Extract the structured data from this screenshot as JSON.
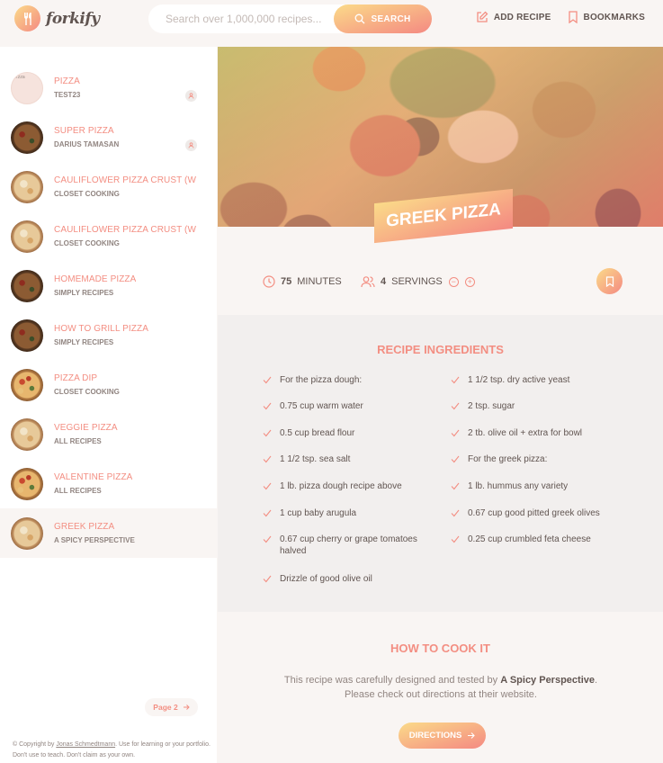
{
  "header": {
    "logo_text": "forkify",
    "search_placeholder": "Search over 1,000,000 recipes...",
    "search_label": "SEARCH",
    "nav": {
      "add_recipe": "ADD RECIPE",
      "bookmarks": "BOOKMARKS"
    }
  },
  "results": [
    {
      "title": "PIZZA",
      "publisher": "TEST23",
      "user": true,
      "thumb_alt": "pizza"
    },
    {
      "title": "SUPER PIZZA",
      "publisher": "DARIUS TAMASAN",
      "user": true
    },
    {
      "title": "CAULIFLOWER PIZZA CRUST (WIT...",
      "publisher": "CLOSET COOKING"
    },
    {
      "title": "CAULIFLOWER PIZZA CRUST (WIT...",
      "publisher": "CLOSET COOKING"
    },
    {
      "title": "HOMEMADE PIZZA",
      "publisher": "SIMPLY RECIPES"
    },
    {
      "title": "HOW TO GRILL PIZZA",
      "publisher": "SIMPLY RECIPES"
    },
    {
      "title": "PIZZA DIP",
      "publisher": "CLOSET COOKING"
    },
    {
      "title": "VEGGIE PIZZA",
      "publisher": "ALL RECIPES"
    },
    {
      "title": "VALENTINE PIZZA",
      "publisher": "ALL RECIPES"
    },
    {
      "title": "GREEK PIZZA",
      "publisher": "A SPICY PERSPECTIVE",
      "active": true
    }
  ],
  "pagination": {
    "next_label": "Page 2"
  },
  "copyright": {
    "prefix": "© Copyright by ",
    "author": "Jonas Schmedtmann",
    "suffix": ". Use for learning or your portfolio. Don't use to teach. Don't claim as your own."
  },
  "recipe": {
    "title": "GREEK PIZZA",
    "time_value": "75",
    "time_unit": "MINUTES",
    "servings_value": "4",
    "servings_unit": "SERVINGS",
    "ingredients_heading": "RECIPE INGREDIENTS",
    "ingredients": [
      " For the pizza dough:",
      "1 1/2 tsp. dry active yeast",
      "0.75 cup warm water",
      "2 tsp. sugar",
      "0.5 cup bread flour",
      "2 tb. olive oil + extra for bowl",
      "1 1/2 tsp. sea salt",
      " For the greek pizza:",
      "1 lb. pizza dough recipe above",
      "1 lb. hummus any variety",
      "1 cup baby arugula",
      "0.67 cup good pitted greek olives",
      "0.67 cup cherry or grape tomatoes halved",
      "0.25 cup crumbled feta cheese",
      " Drizzle of good olive oil"
    ],
    "cook_heading": "HOW TO COOK IT",
    "cook_text_prefix": "This recipe was carefully designed and tested by ",
    "cook_publisher": "A Spicy Perspective",
    "cook_text_suffix": ". Please check out directions at their website.",
    "directions_label": "DIRECTIONS"
  },
  "colors": {
    "accent": "#f38e82",
    "grad_start": "#fbdb89",
    "grad_end": "#f48982"
  }
}
